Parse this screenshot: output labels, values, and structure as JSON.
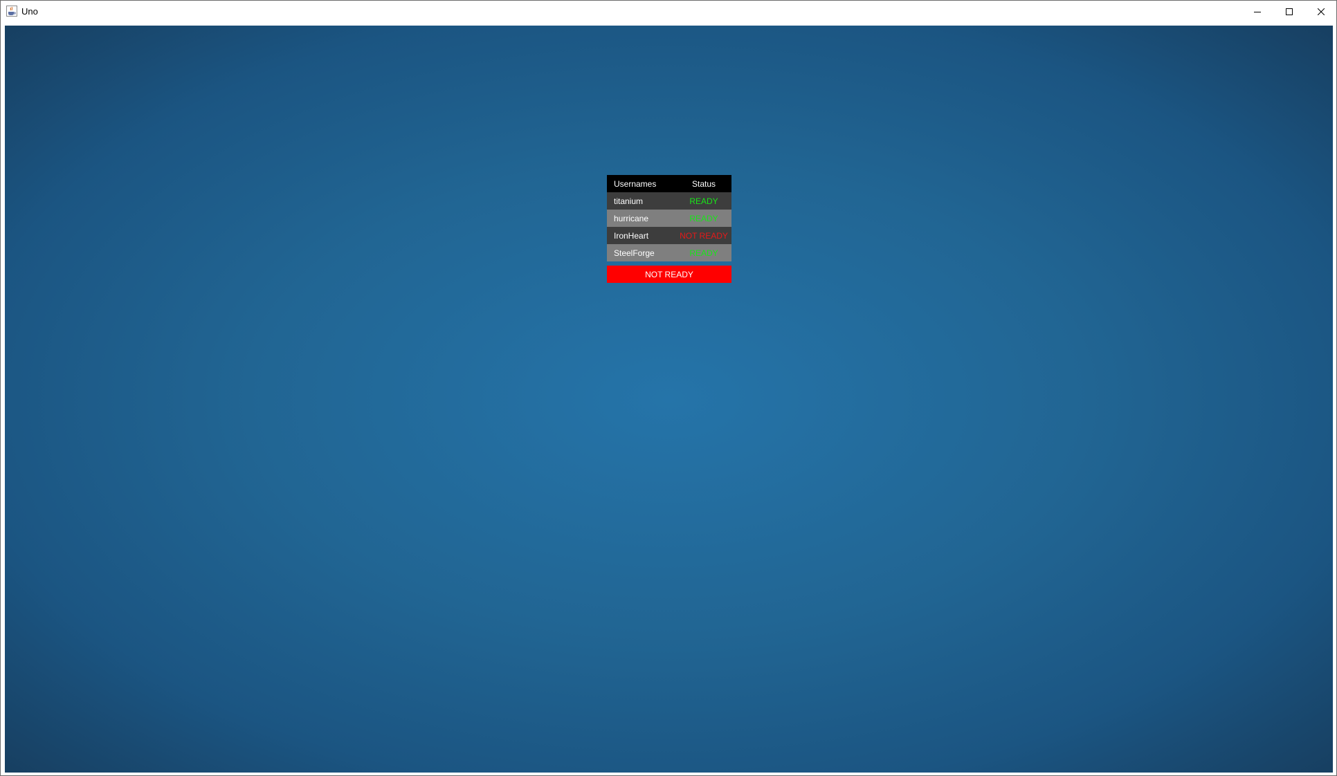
{
  "window": {
    "title": "Uno",
    "icon": "java-cup-icon",
    "controls": [
      "minimize-icon",
      "maximize-icon",
      "close-icon"
    ]
  },
  "colors": {
    "background_center": "#2574a9",
    "background_edge": "#173f61",
    "header_bg": "#000000",
    "row_dark": "#3d3d3d",
    "row_light": "#7f7f7f",
    "ready": "#19e619",
    "not_ready": "#e61919",
    "toggle_button": "#ff0000"
  },
  "lobby": {
    "headers": {
      "username": "Usernames",
      "status": "Status"
    },
    "players": [
      {
        "username": "titanium",
        "status": "READY"
      },
      {
        "username": "hurricane",
        "status": "READY"
      },
      {
        "username": "IronHeart",
        "status": "NOT READY"
      },
      {
        "username": "SteelForge",
        "status": "READY"
      }
    ],
    "toggle_button_label": "NOT READY"
  }
}
